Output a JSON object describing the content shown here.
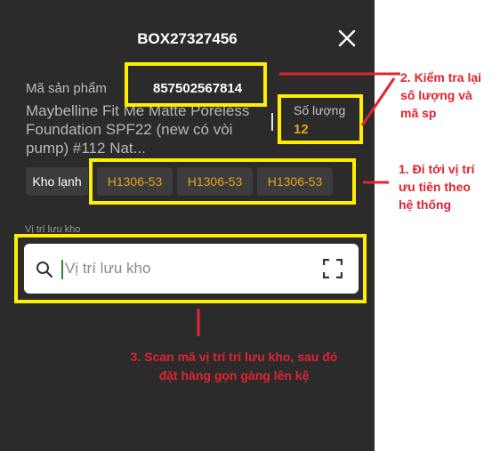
{
  "screen": {
    "title": "BOX27327456",
    "product_code_label": "Mã sản phẩm",
    "product_code_value": "857502567814",
    "product_name": "Maybelline Fit Me Matte Poreless Foundation SPF22 (new có vòi pump) #112 Nat...",
    "quantity_label": "Số lượng",
    "quantity_value": "12",
    "warehouse_chip": "Kho lạnh",
    "location_chips": [
      "H1306-53",
      "H1306-53",
      "H1306-53"
    ],
    "storage_label": "Vị trí lưu kho",
    "search_placeholder": "Vị trí lưu kho"
  },
  "annotations": {
    "note_2": [
      "2. Kiểm tra lại",
      "số lượng và",
      "mã sp"
    ],
    "note_1": [
      "1. Đi tới vị trí",
      "ưu tiên theo",
      "hệ thống"
    ],
    "note_3": [
      "3. Scan mã vị trí trí lưu kho, sau đó",
      "đặt hàng gọn gàng lên kệ"
    ]
  },
  "colors": {
    "panel_bg": "#2b2b2b",
    "accent_orange": "#e5a21f",
    "highlight_yellow": "#ffee00",
    "annotation_red": "#e0242d"
  },
  "icons": {
    "close": "close-icon",
    "search": "search-icon",
    "scan": "scan-frame-icon"
  }
}
